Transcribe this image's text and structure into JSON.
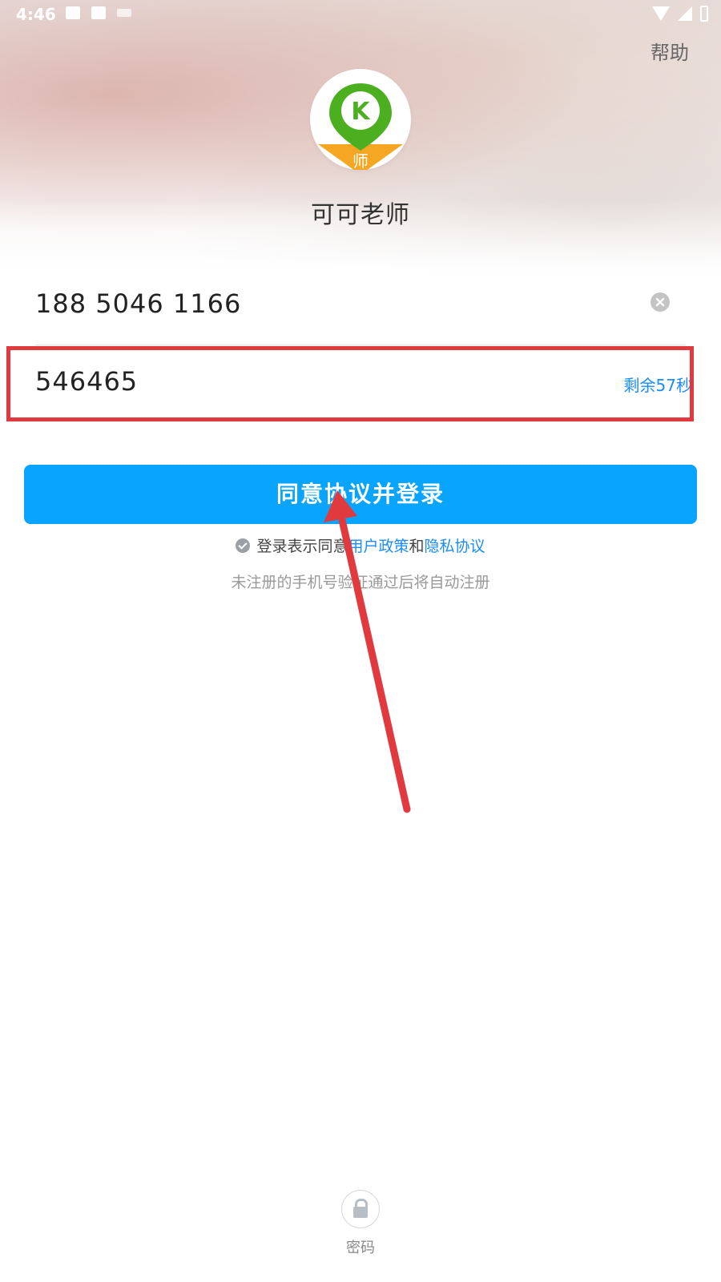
{
  "status_bar": {
    "time": "4:46"
  },
  "header": {
    "help_label": "帮助",
    "app_name": "可可老师",
    "logo_badge": "师",
    "logo_letter": "K"
  },
  "form": {
    "phone_value": "188 5046 1166",
    "code_value": "546465",
    "countdown_label": "剩余57秒"
  },
  "actions": {
    "login_button_label": "同意协议并登录"
  },
  "agreement": {
    "prefix": "登录表示同意",
    "user_policy": "用户政策",
    "and": "和",
    "privacy": "隐私协议",
    "register_tip": "未注册的手机号验证通过后将自动注册"
  },
  "footer": {
    "password_login_label": "密码"
  },
  "colors": {
    "primary_button": "#08a4fd",
    "link": "#1a8cff",
    "active_underline": "#f5a623",
    "annotation": "#e03a3e",
    "logo_green": "#4caf1f",
    "logo_orange": "#f5a623"
  },
  "icons": [
    "clear-icon",
    "check-circle-icon",
    "lock-icon",
    "location-pin-logo"
  ]
}
